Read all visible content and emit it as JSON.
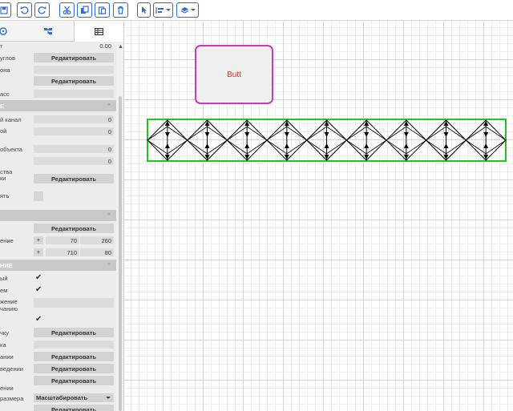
{
  "toolbar": {
    "icons": [
      "save-icon",
      "undo-icon",
      "redo-icon",
      "cut-icon",
      "copy-icon",
      "paste-icon",
      "delete-icon",
      "pointer-icon",
      "align-icon",
      "layers-icon"
    ],
    "accent": "#2b6fd6"
  },
  "panel": {
    "tabs": [
      "properties-tab",
      "hierarchy-tab",
      "table-tab"
    ],
    "rows": {
      "r1_label": "т",
      "r1_value": "0.00",
      "r2_label": "углов",
      "r2_button": "Редактировать",
      "r3_label": "она",
      "r4_button": "Редактировать",
      "r5_label": "асс",
      "section1": "Е",
      "r6_label": "й канал",
      "r6_value": "0",
      "r7_label": "ой",
      "r7_value": "0",
      "r8_label": "объекта",
      "r8_value": "0",
      "r9_value": "0",
      "r10_label": "ства",
      "r10b_label": "ки",
      "r10_button": "Редактировать",
      "r11_label": "ять",
      "r12_button": "Редактировать",
      "r13_label": "ение",
      "r13_plus": "+",
      "r13_v1": "70",
      "r13_v2": "260",
      "r14_plus": "+",
      "r14_v1": "710",
      "r14_v2": "80",
      "section2": "НИЕ",
      "r15_label": "ый",
      "r16_label": "ем",
      "r17_label": "жение",
      "r17b_label": "чанию",
      "r18_label": "чку",
      "r18_button": "Редактировать",
      "r19_label": "ка",
      "r20_label": "ании",
      "r20_button": "Редактировать",
      "r21_label": "ведении",
      "r21_button": "Редактировать",
      "r22_button": "Редактировать",
      "r23_label": "ении",
      "r24_label": "размера",
      "r24_select": "Масштабировать",
      "r25_button": "Редактировать"
    }
  },
  "canvas": {
    "butt_label": "Butt",
    "butt_border": "#c33bc3",
    "butt_text_color": "#c0392b",
    "array_border": "#22c422",
    "array_cells": 9
  }
}
